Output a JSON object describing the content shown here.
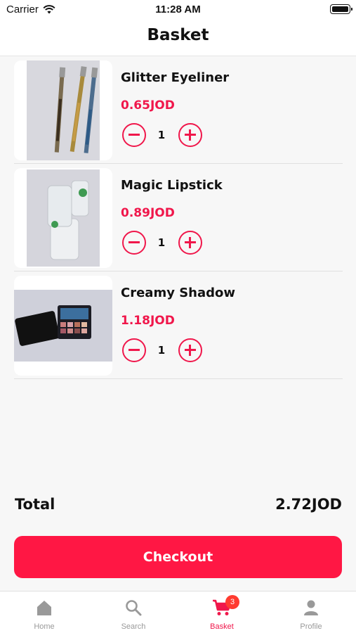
{
  "status_bar": {
    "carrier": "Carrier",
    "time": "11:28 AM"
  },
  "header": {
    "title": "Basket"
  },
  "items": [
    {
      "name": "Glitter Eyeliner",
      "price": "0.65JOD",
      "quantity": "1",
      "image": "eyeliner-pencils"
    },
    {
      "name": "Magic Lipstick",
      "price": "0.89JOD",
      "quantity": "1",
      "image": "clear-lipsticks"
    },
    {
      "name": "Creamy Shadow",
      "price": "1.18JOD",
      "quantity": "1",
      "image": "eyeshadow-palette"
    }
  ],
  "summary": {
    "total_label": "Total",
    "total_value": "2.72JOD"
  },
  "checkout": {
    "label": "Checkout"
  },
  "tabbar": {
    "tabs": [
      {
        "label": "Home",
        "icon": "home-icon"
      },
      {
        "label": "Search",
        "icon": "search-icon"
      },
      {
        "label": "Basket",
        "icon": "cart-icon",
        "badge": "3",
        "active": true
      },
      {
        "label": "Profile",
        "icon": "person-icon"
      }
    ]
  },
  "colors": {
    "accent": "#f0174b",
    "checkout": "#ff1744",
    "badge": "#ff3b30"
  }
}
